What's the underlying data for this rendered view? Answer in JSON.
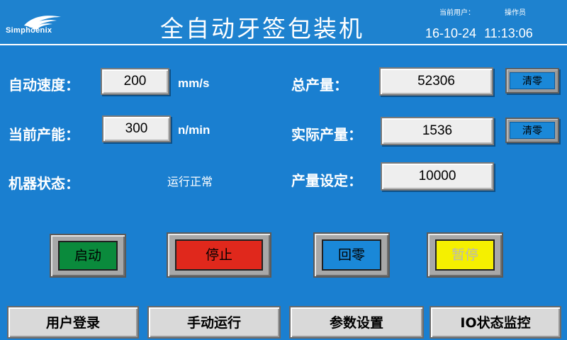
{
  "header": {
    "logo_text": "Simphoenix",
    "title": "全自动牙签包装机",
    "current_user_label": "当前用户：",
    "current_user": "操作员",
    "date": "16-10-24",
    "time": "11:13:06"
  },
  "speed": {
    "label": "自动速度：",
    "value": "200",
    "unit": "mm/s"
  },
  "capacity": {
    "label": "当前产能：",
    "value": "300",
    "unit": "n/min"
  },
  "machine_state": {
    "label": "机器状态：",
    "value": "运行正常"
  },
  "total_output": {
    "label": "总产量：",
    "value": "52306",
    "clear_label": "清零"
  },
  "actual_output": {
    "label": "实际产量：",
    "value": "1536",
    "clear_label": "清零"
  },
  "output_setting": {
    "label": "产量设定：",
    "value": "10000"
  },
  "controls": {
    "start": "启动",
    "stop": "停止",
    "home": "回零",
    "pause": "暂停"
  },
  "nav": {
    "login": "用户登录",
    "manual": "手动运行",
    "params": "参数设置",
    "io": "IO状态监控"
  },
  "colors": {
    "background": "#1a7fd0",
    "start": "#0a8a3c",
    "stop": "#e0281c",
    "home": "#1a88d8",
    "pause": "#f5f000"
  }
}
